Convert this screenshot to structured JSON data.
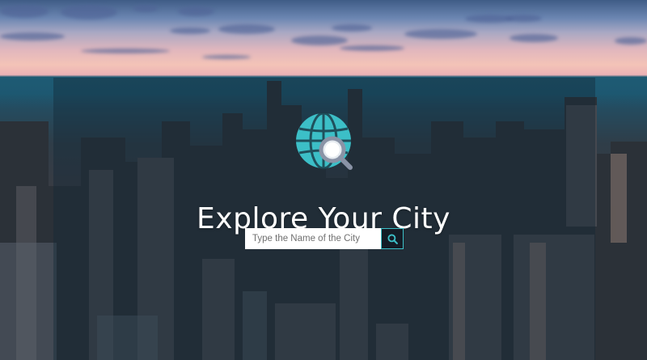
{
  "hero": {
    "title": "Explore Your City",
    "logo_icon": "globe-search-icon"
  },
  "search": {
    "placeholder": "Type the Name of the City",
    "value": "",
    "button_icon": "search-icon"
  },
  "colors": {
    "accent": "#3cbfc7",
    "button_bg": "#141c26",
    "title_text": "#ffffff"
  }
}
